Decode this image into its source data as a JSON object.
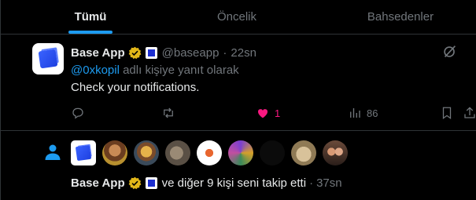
{
  "tabs": [
    {
      "label": "Tümü",
      "active": true
    },
    {
      "label": "Öncelik",
      "active": false
    },
    {
      "label": "Bahsedenler",
      "active": false
    }
  ],
  "reply": {
    "author_name": "Base App",
    "handle": "@baseapp",
    "separator": "·",
    "time": "22sn",
    "replying_mention": "@0xkopil",
    "replying_rest": " adlı kişiye yanıt olarak",
    "text": "Check your notifications.",
    "actions": {
      "reply_count": "",
      "retweet_count": "",
      "like_count": "1",
      "views_count": "86"
    }
  },
  "follow": {
    "author_name": "Base App",
    "text": "ve diğer 9 kişi seni takip etti",
    "separator": "·",
    "time": "37sn",
    "faces": [
      "base-app-logo",
      "man-with-beard-photo",
      "dog-cartoon-photo",
      "animal-photo",
      "orange-logo-photo",
      "purple-pattern-photo",
      "dark-photo",
      "dog-face-photo",
      "couple-photo"
    ]
  },
  "colors": {
    "accent": "#1d9bf0",
    "like": "#f91880",
    "muted": "#71767b",
    "verified_gold": "#e2b719"
  }
}
